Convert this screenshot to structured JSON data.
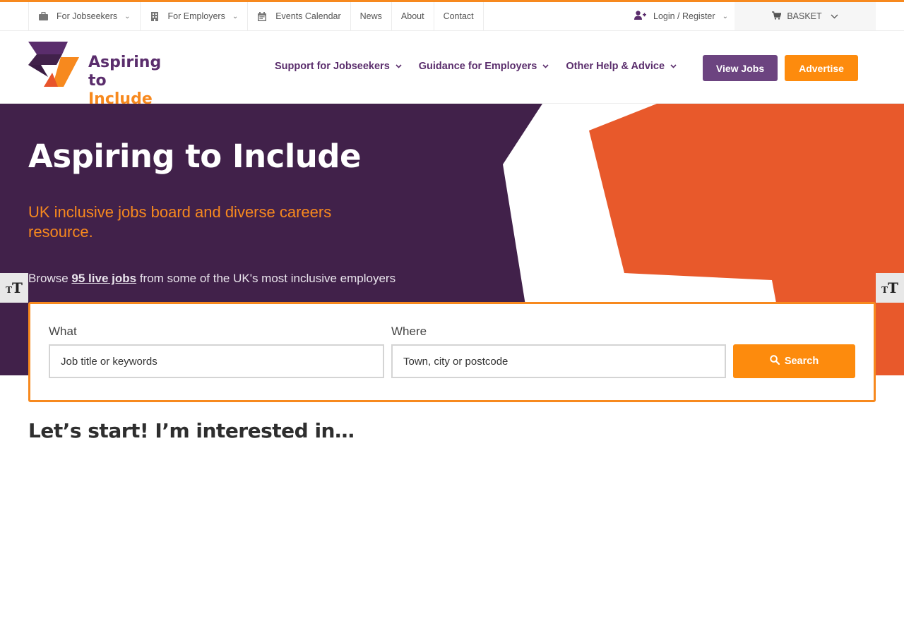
{
  "topbar": {
    "items": [
      {
        "label": "For Jobseekers",
        "icon": "briefcase-icon",
        "has_dropdown": true
      },
      {
        "label": "For Employers",
        "icon": "building-icon",
        "has_dropdown": true
      },
      {
        "label": "Events Calendar",
        "icon": "calendar-icon",
        "has_dropdown": false
      },
      {
        "label": "News"
      },
      {
        "label": "About"
      },
      {
        "label": "Contact"
      }
    ],
    "login": "Login / Register",
    "basket": "BASKET"
  },
  "brand": {
    "line1": "Aspiring to",
    "line2": "Include",
    "colors": {
      "purple": "#5a2d6c",
      "orange": "#f7891e",
      "red": "#e8542b"
    }
  },
  "mainnav": {
    "items": [
      {
        "label": "Support for Jobseekers"
      },
      {
        "label": "Guidance for Employers"
      },
      {
        "label": "Other Help & Advice"
      }
    ],
    "view_jobs": "View Jobs",
    "advertise": "Advertise"
  },
  "hero": {
    "title": "Aspiring to Include",
    "subtitle": "UK inclusive jobs board and diverse careers resource.",
    "browse_prefix": "Browse",
    "browse_link": "95 live jobs",
    "browse_suffix": "from some of the UK's most inclusive employers",
    "bg_color": "#41214a"
  },
  "search": {
    "what_label": "What",
    "what_placeholder": "Job title or keywords",
    "where_label": "Where",
    "where_placeholder": "Town, city or postcode",
    "button": "Search"
  },
  "section": {
    "heading": "Let’s start! I’m interested in…"
  }
}
